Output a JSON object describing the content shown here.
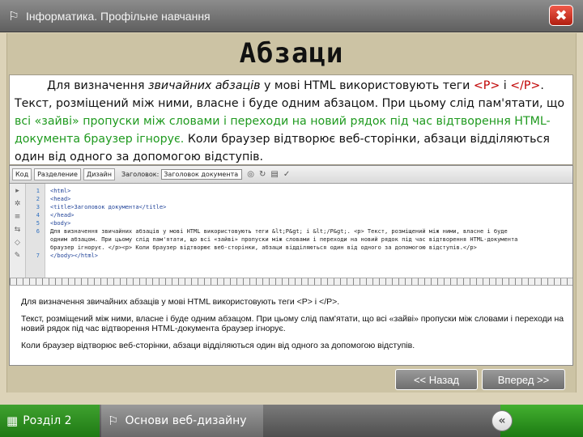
{
  "window": {
    "title": "Інформатика. Профільне навчання",
    "title_icon": "pennant-icon",
    "close_icon": "close-icon"
  },
  "slide": {
    "title": "Абзаци"
  },
  "paragraph": {
    "p1": "Для визначення ",
    "p2": "звичайних абзаців",
    "p3": " у мові HTML використовують теги ",
    "tag_open": "<P>",
    "p4": " і ",
    "tag_close": "</P>",
    "p5": ". Текст, розміщений між ними, власне і буде одним абзацом. При цьому слід пам'ятати, що ",
    "green_text": "всі «зайві» пропуски між  словами і переходи на новий рядок під час відтворення HTML-документа браузер ігнорує.",
    "p6": " Коли браузер відтворює веб-сторінки, абзаци відділяються один від одного за допомогою відступів."
  },
  "screenshot": {
    "toolbar": {
      "code_label": "Код",
      "split_label": "Разделение",
      "design_label": "Дизайн",
      "title_label": "Заголовок:",
      "title_value": "Заголовок документа"
    },
    "line_numbers": [
      "1",
      "2",
      "3",
      "4",
      "5",
      "6",
      "",
      "",
      "7"
    ],
    "code_lines": [
      "<html>",
      "<head>",
      "<title>Заголовок документа</title>",
      "</head>",
      "<body>",
      "Для визначення звичайних абзаців у мові HTML використовують теги &lt;P&gt; і &lt;/P&gt;. <p> Текст, розміщений між ними, власне і буде",
      "одним абзацом. При цьому слід пам'ятати, що всі «зайві» пропуски між  словами і переходи на новий рядок під час відтворення HTML-документа",
      "браузер ігнорує. </p><p> Коли браузер відтворює веб-сторінки, абзаци відділяються один від одного за допомогою відступів.</p>",
      "</body></html>"
    ],
    "design_p1": "Для визначення звичайних абзаців у мові HTML використовують теги <P> і </P>.",
    "design_p2": "Текст, розміщений між ними, власне і буде одним абзацом. При цьому слід пам'ятати, що всі «зайві» пропуски між словами і переходи на новий рядок під час відтворення HTML-документа браузер ігнорує.",
    "design_p3": "Коли браузер відтворює веб-сторінки, абзаци відділяються один від одного за допомогою відступів."
  },
  "navigation": {
    "prev": "<< Назад",
    "next": "Вперед >>"
  },
  "footer": {
    "section": "Розділ 2",
    "topic": "Основи веб-дизайну",
    "back_icon": "double-chevron-left-icon"
  },
  "colors": {
    "tag_red": "#c00000",
    "highlight_green": "#1f9a1f",
    "section_green": "#2e8f20"
  }
}
